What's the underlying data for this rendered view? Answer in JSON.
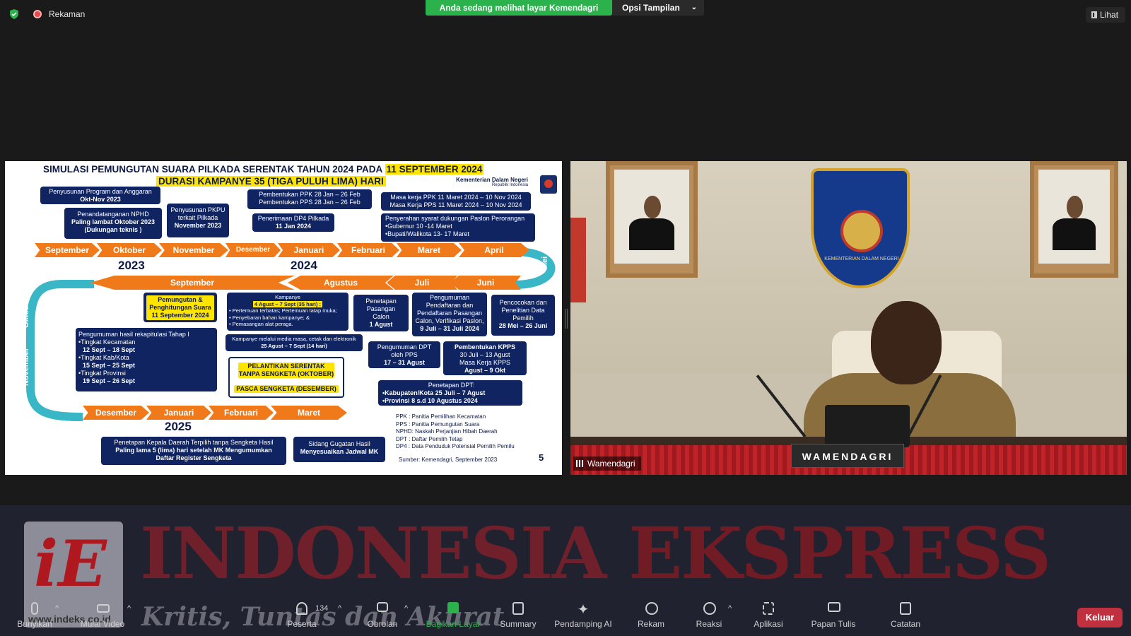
{
  "topbar": {
    "recording_label": "Rekaman",
    "banner_text": "Anda sedang melihat layar Kemendagri",
    "view_options_label": "Opsi Tampilan",
    "view_button_label": "Lihat"
  },
  "slide": {
    "title_line1": "SIMULASI PEMUNGUTAN SUARA PILKADA SERENTAK TAHUN 2024 PADA",
    "title_highlight": "11 SEPTEMBER 2024",
    "title_line2": "DURASI KAMPANYE 35 (TIGA PULUH LIMA)  HARI",
    "org_name": "Kementerian Dalam Negeri",
    "org_sub": "Republik Indonesia",
    "months_top": [
      "September",
      "Oktober",
      "November",
      "Desember",
      "Januari",
      "Februari",
      "Maret",
      "April"
    ],
    "months_mid": [
      "September",
      "Agustus",
      "Juli",
      "Juni"
    ],
    "months_bottom": [
      "Desember",
      "Januari",
      "Februari",
      "Maret"
    ],
    "side_months": [
      "Mei",
      "Oktober",
      "November"
    ],
    "years": [
      "2023",
      "2024",
      "2025"
    ],
    "boxes": {
      "program_anggaran_1": "Penyusunan Program dan Anggaran",
      "program_anggaran_2": "Okt-Nov 2023",
      "npho_1": "Penandatanganan NPHD",
      "npho_2": "Paling lambat Oktober 2023",
      "npho_3": "(Dukungan teknis )",
      "pkpu_1": "Penyusunan PKPU",
      "pkpu_2": "terkait Pilkada",
      "pkpu_3": "November 2023",
      "ppk_pps_1": "Pembentukan PPK 28 Jan – 26 Feb",
      "ppk_pps_2": "Pembentukan PPS 28 Jan – 26 Feb",
      "dp4_1": "Penerimaan DP4 Pilkada",
      "dp4_2": "11 Jan 2024",
      "masa_kerja_1": "Masa kerja PPK 11 Maret 2024 – 10 Nov 2024",
      "masa_kerja_2": "Masa Kerja PPS 11 Maret 2024 – 10 Nov 2024",
      "syarat_1": "Penyerahan syarat dukungan Paslon Perorangan",
      "syarat_2": "•Gubernur 10 -14 Maret",
      "syarat_3": "•Bupati/Walikota 13- 17 Maret",
      "pemungutan_1": "Pemungutan &",
      "pemungutan_2": "Penghitungan Suara",
      "pemungutan_3": "11 September 2024",
      "kampanye_1": "Kampanye",
      "kampanye_2": "4 Agust – 7 Sept (35 hari) :",
      "kampanye_3": "• Pertemuan terbatas; Pertemuan tatap muka;",
      "kampanye_4": "• Penyebaran bahan kampanye; &",
      "kampanye_5": "• Pemasangan alat peraga.",
      "pasangan_1": "Penetapan",
      "pasangan_2": "Pasangan",
      "pasangan_3": "Calon",
      "pasangan_4": "1 Agust",
      "pendaftaran_1": "Pengumuman",
      "pendaftaran_2": "Pendaftaran dan",
      "pendaftaran_3": "Pendaftaran Pasangan",
      "pendaftaran_4": "Calon, Verifikasi Paslon,",
      "pendaftaran_5": "9 Juli  – 31 Juli 2024",
      "pencocokan_1": "Pencocokan dan",
      "pencocokan_2": "Penelitian Data",
      "pencocokan_3": "Pemilih",
      "pencocokan_4": "28 Mei – 26 Juni",
      "rekap_1": "Pengumuman hasil rekapitulasi Tahap I",
      "rekap_2": "•Tingkat Kecamatan",
      "rekap_3": "12 Sept – 18 Sept",
      "rekap_4": "•Tingkat Kab/Kota",
      "rekap_5": "15 Sept – 25 Sept",
      "rekap_6": "•Tingkat Provinsi",
      "rekap_7": "19 Sept – 26 Sept",
      "media_1": "Kampanye melalui media masa, cetak dan elektronik",
      "media_2": "25 Agust – 7 Sept (14 hari)",
      "dpt_pps_1": "Pengumuman DPT",
      "dpt_pps_2": "oleh PPS",
      "dpt_pps_3": "17 – 31 Agust",
      "kpps_1": "Pembentukan KPPS",
      "kpps_2": "30 Juli – 13 Agust",
      "kpps_3": "Masa Kerja KPPS",
      "kpps_4": "Agust – 9 Okt",
      "pelantikan_1": "PELANTIKAN SERENTAK",
      "pelantikan_2": "TANPA SENGKETA (OKTOBER)",
      "pelantikan_3": "PASCA SENGKETA (DESEMBER)",
      "penetapan_dpt_1": "Penetapan DPT:",
      "penetapan_dpt_2": "•Kabupaten/Kota  25 Juli – 7 Agust",
      "penetapan_dpt_3": "•Provinsi 8 s.d 10 Agustus 2024",
      "kepala_1": "Penetapan Kepala Daerah Terpilih tanpa Sengketa Hasil",
      "kepala_2": "Paling lama 5 (lima) hari setelah MK Mengumumkan",
      "kepala_3": "Daftar Register Sengketa",
      "sidang_1": "Sidang Gugatan Hasil",
      "sidang_2": "Menyesuaikan Jadwal MK"
    },
    "legend": [
      "PPK : Panitia Pemilihan Kecamatan",
      "PPS : Panitia Pemungutan Suara",
      "NPHD: Naskah Perjanjian Hibah Daerah",
      "DPT : Daftar Pemilih Tetap",
      "DP4 : Data Penduduk Potensial Pemilih Pemilu"
    ],
    "source": "Sumber: Kemendagri, September 2023",
    "page_number": "5"
  },
  "video": {
    "participant_name": "Wamendagri",
    "nameplate": "WAMENDAGRI",
    "emblem_text": "KEMENTERIAN DALAM NEGERI"
  },
  "watermark": {
    "logo_text": "iE",
    "url": "www.indeks.co.id",
    "title_a": "INDONESIA",
    "title_b": "EKSPRESS",
    "tagline": "Kritis, Tuntas dan Akurat"
  },
  "toolbar": {
    "unmute": "Bunyikan",
    "start_video": "Mulai Video",
    "participants": "Peserta",
    "participants_count": "134",
    "chat": "Obrolan",
    "share": "Bagikan Layar",
    "summary": "Summary",
    "ai": "Pendamping AI",
    "record": "Rekam",
    "reactions": "Reaksi",
    "apps": "Aplikasi",
    "whiteboard": "Papan Tulis",
    "notes": "Catatan",
    "leave": "Keluar"
  },
  "colors": {
    "banner_green": "#2bb24c",
    "slide_navy": "#0f2461",
    "timeline_orange": "#f07a1a",
    "timeline_teal": "#3ab7c7",
    "highlight_yellow": "#ffe400",
    "leave_red": "#c0313f"
  }
}
